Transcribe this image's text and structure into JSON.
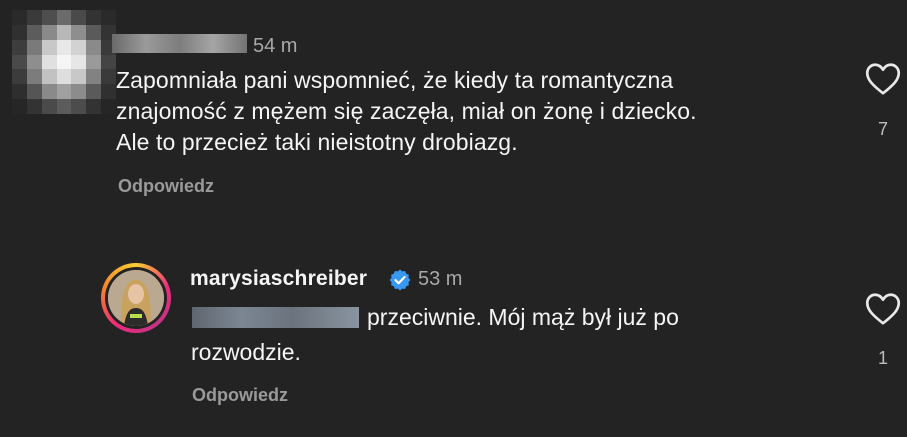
{
  "comment1": {
    "time": "54 m",
    "lines": [
      "Zapomniała pani wspomnieć, że kiedy ta romantyczna",
      "znajomość z mężem się zaczęła, miał on żonę i dziecko.",
      "Ale to przecież taki nieistotny drobiazg."
    ],
    "reply_label": "Odpowiedz",
    "likes": "7"
  },
  "comment2": {
    "username": "marysiaschreiber",
    "time": "53 m",
    "text_line1": "przeciwnie. Mój mąż był już po",
    "text_line2": "rozwodzie.",
    "reply_label": "Odpowiedz",
    "likes": "1"
  },
  "colors": {
    "background": "#232323",
    "text": "#f5f5f5",
    "muted": "#a8a8a8",
    "verified": "#3897f0"
  },
  "icons": {
    "like": "heart-icon",
    "verified": "verified-badge-icon"
  }
}
